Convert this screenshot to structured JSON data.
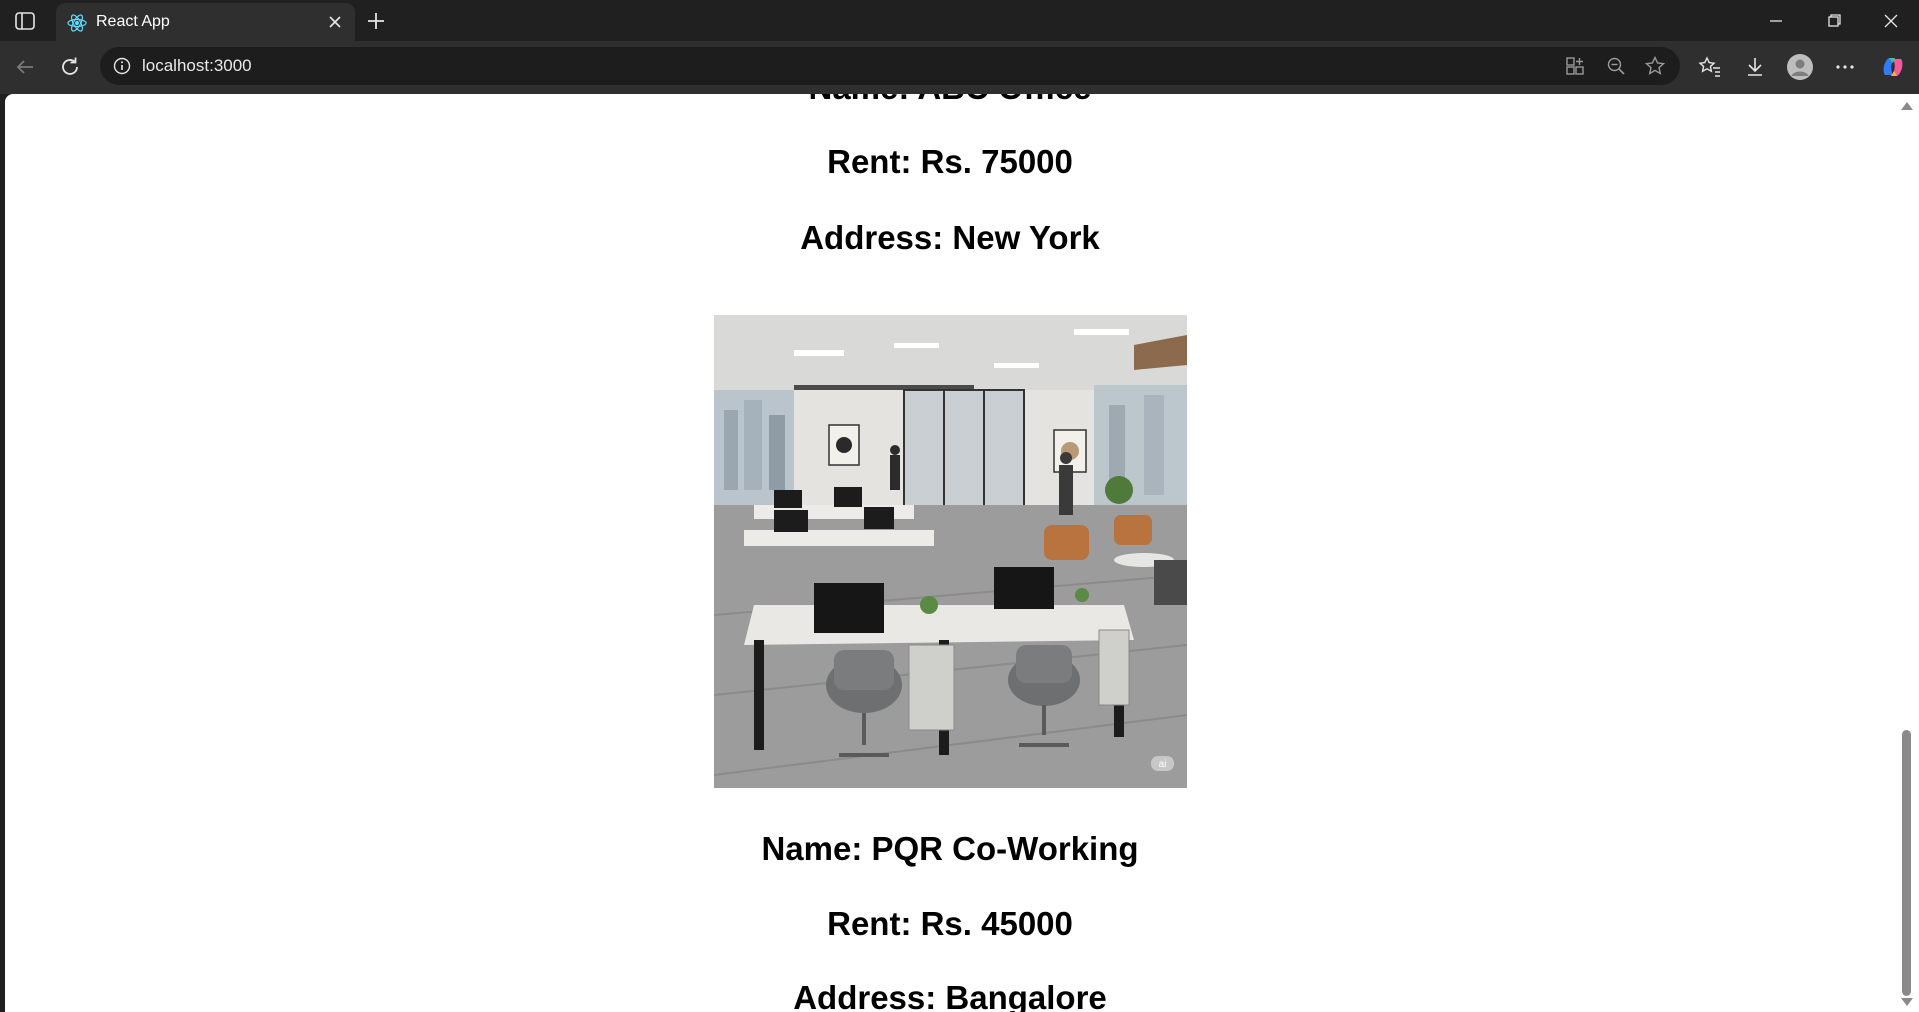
{
  "browser": {
    "tab_title": "React App",
    "url": "localhost:3000",
    "icons": [
      "sidebar-toggle-icon",
      "react-icon",
      "close-icon",
      "new-tab-icon",
      "minimize-icon",
      "restore-icon",
      "window-close-icon",
      "back-icon",
      "refresh-icon",
      "info-icon",
      "app-available-icon",
      "zoom-out-icon",
      "favorite-star-icon",
      "favorites-icon",
      "downloads-icon",
      "profile-icon",
      "more-icon",
      "copilot-icon"
    ],
    "accent_color": "#61dafb"
  },
  "listings": [
    {
      "name": "Name: ABC Office",
      "rent": "Rent: Rs. 75000",
      "address": "Address: New York"
    },
    {
      "name": "Name: PQR Co-Working",
      "rent": "Rent: Rs. 45000",
      "address": "Address: Bangalore",
      "image_watermark": "ai"
    }
  ]
}
